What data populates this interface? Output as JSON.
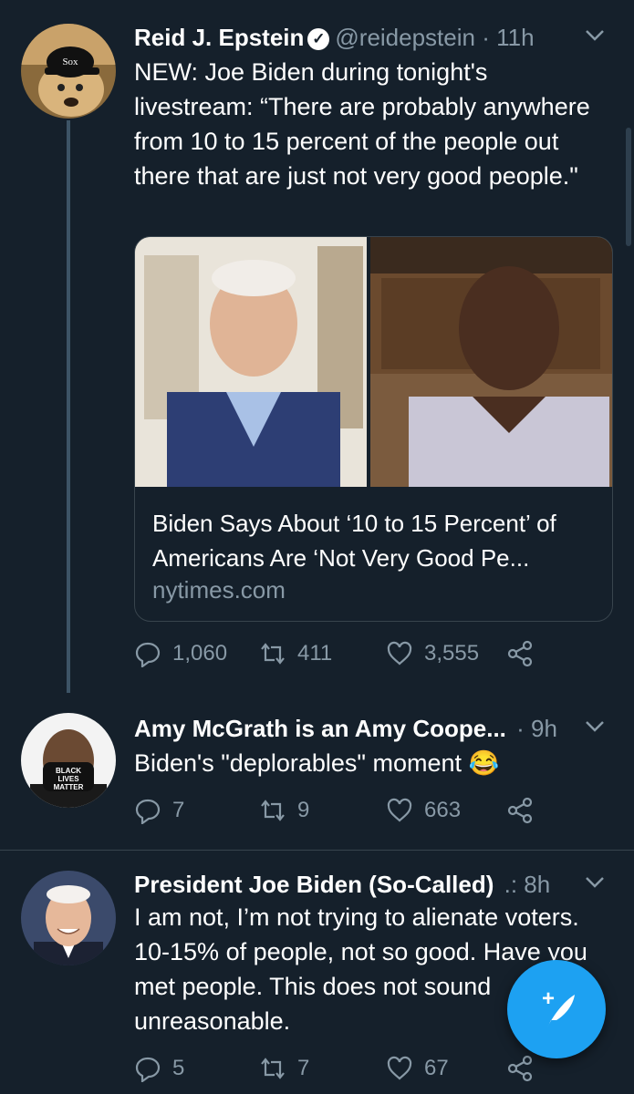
{
  "tweets": [
    {
      "name": "Reid J. Epstein",
      "verified": true,
      "handle": "@reidepstein",
      "time": "· 11h",
      "text": "NEW: Joe Biden during tonight's livestream: “There are probably anywhere from 10 to 15 percent of the people out there that are just not very good people.\"",
      "card": {
        "title": "Biden Says About ‘10 to 15 Percent’ of Americans Are ‘Not Very Good Pe...",
        "domain": "nytimes.com"
      },
      "replies": "1,060",
      "retweets": "411",
      "likes": "3,555"
    },
    {
      "name": "Amy McGrath is an Amy Coope...",
      "time": "· 9h",
      "text": "Biden's \"deplorables\" moment 😂",
      "avatar_text": "BLACK LIVES MATTER",
      "replies": "7",
      "retweets": "9",
      "likes": "663"
    },
    {
      "name": "President Joe Biden (So-Called)",
      "time": ".: 8h",
      "text": "I am not, I’m not trying to alienate voters. 10-15% of people, not so good. Have you met people. This does not sound unreasonable.",
      "replies": "5",
      "retweets": "7",
      "likes": "67"
    }
  ],
  "colors": {
    "background": "#15202b",
    "secondary_text": "#8899a6",
    "accent": "#1da1f2",
    "divider": "#38444d"
  },
  "icons": [
    "chevron-down-icon",
    "verified-icon",
    "reply-icon",
    "retweet-icon",
    "like-icon",
    "share-icon",
    "compose-icon"
  ]
}
